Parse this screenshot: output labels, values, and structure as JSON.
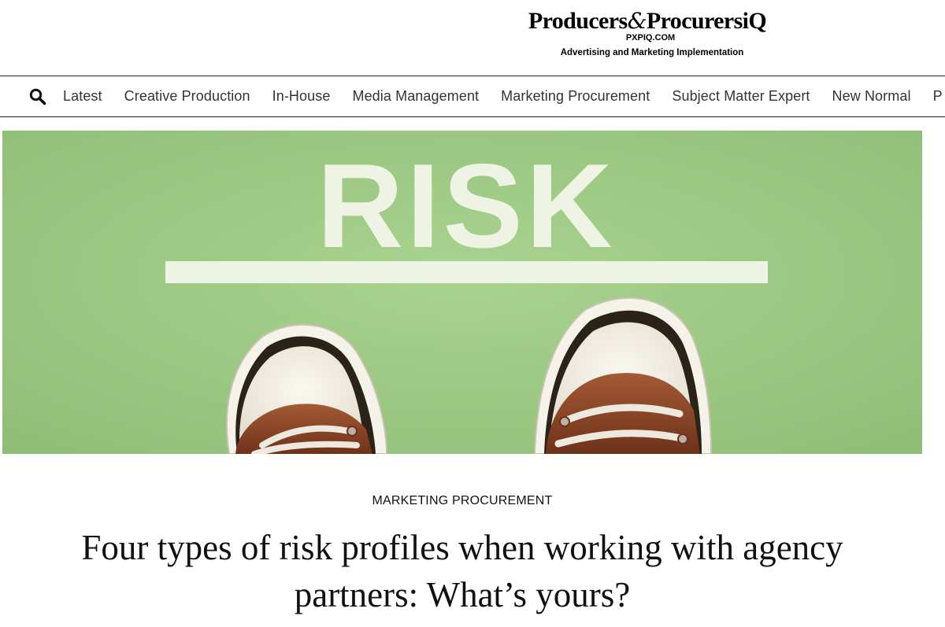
{
  "masthead": {
    "logo_left": "Producers",
    "logo_amp": "&",
    "logo_right": "ProcurersiQ",
    "domain": "PXPIQ.COM",
    "tagline": "Advertising and Marketing Implementation"
  },
  "nav": {
    "search_icon": "search-icon",
    "items": [
      {
        "label": "Latest"
      },
      {
        "label": "Creative Production"
      },
      {
        "label": "In-House"
      },
      {
        "label": "Media Management"
      },
      {
        "label": "Marketing Procurement"
      },
      {
        "label": "Subject Matter Expert"
      },
      {
        "label": "New Normal"
      },
      {
        "label": "P"
      }
    ]
  },
  "hero": {
    "word": "RISK",
    "background": "#9fcb86",
    "accent_text": "#eef3e4"
  },
  "article": {
    "category": "MARKETING PROCUREMENT",
    "title": "Four types of risk profiles when working with agency partners: What’s yours?"
  }
}
